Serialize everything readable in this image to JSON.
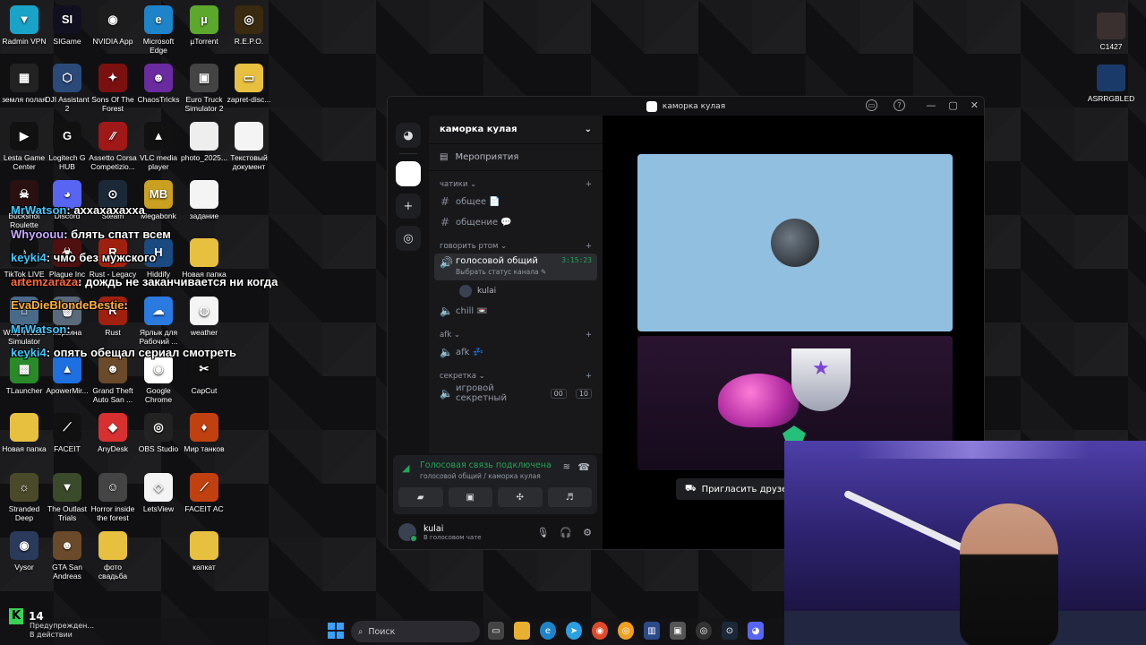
{
  "desktop": {
    "icons": [
      {
        "label": "Radmin VPN",
        "color": "#1aa3c9",
        "glyph": "▼"
      },
      {
        "label": "SIGame",
        "color": "#101020",
        "glyph": "SI"
      },
      {
        "label": "NVIDIA App",
        "color": "#1c1c1c",
        "glyph": "◉"
      },
      {
        "label": "Microsoft Edge",
        "color": "#1e84c9",
        "glyph": "e"
      },
      {
        "label": "µTorrent",
        "color": "#5ca82c",
        "glyph": "µ"
      },
      {
        "label": "R.E.P.O.",
        "color": "#3a2a10",
        "glyph": "◎"
      },
      {
        "label": "земля полая",
        "color": "#222",
        "glyph": "▦"
      },
      {
        "label": "DJI Assistant 2",
        "color": "#2b4a7a",
        "glyph": "⬡"
      },
      {
        "label": "Sons Of The Forest",
        "color": "#7a1010",
        "glyph": "✦"
      },
      {
        "label": "ChaosTricks",
        "color": "#6a2aa0",
        "glyph": "☻"
      },
      {
        "label": "Euro Truck Simulator 2",
        "color": "#444",
        "glyph": "▣"
      },
      {
        "label": "zapret-disc...",
        "color": "#e8c040",
        "glyph": "▭"
      },
      {
        "label": "Lesta Game Center",
        "color": "#111",
        "glyph": "▶"
      },
      {
        "label": "Logitech G HUB",
        "color": "#111",
        "glyph": "G"
      },
      {
        "label": "Assetto Corsa Competizio...",
        "color": "#a01818",
        "glyph": "⁄⁄"
      },
      {
        "label": "VLC media player",
        "color": "#111",
        "glyph": "▲"
      },
      {
        "label": "photo_2025...",
        "color": "#eee",
        "glyph": ""
      },
      {
        "label": "Текстовый документ",
        "color": "#f4f4f4",
        "glyph": ""
      },
      {
        "label": "Buckshot Roulette",
        "color": "#2a1010",
        "glyph": "☠"
      },
      {
        "label": "Discord",
        "color": "#5865f2",
        "glyph": "◕"
      },
      {
        "label": "Steam",
        "color": "#1b2838",
        "glyph": "⊙"
      },
      {
        "label": "Megabonk",
        "color": "#caa020",
        "glyph": "MB"
      },
      {
        "label": "задание",
        "color": "#f4f4f4",
        "glyph": ""
      },
      {
        "label": "TikTok LIVE Studio",
        "color": "#111",
        "glyph": "♪"
      },
      {
        "label": "Plague Inc Evolved",
        "color": "#501010",
        "glyph": "☣"
      },
      {
        "label": "Rust - Legacy",
        "color": "#a02010",
        "glyph": "R"
      },
      {
        "label": "Hiddify",
        "color": "#1a4a80",
        "glyph": "H"
      },
      {
        "label": "Новая папка",
        "color": "#e8c040",
        "glyph": ""
      },
      {
        "label": "Wrap House Simulator",
        "color": "#4a6a8a",
        "glyph": "⌂"
      },
      {
        "label": "Корзина",
        "color": "#5a6a7a",
        "glyph": "🗑"
      },
      {
        "label": "Rust",
        "color": "#a02010",
        "glyph": "R"
      },
      {
        "label": "Ярлык для Рабочий ...",
        "color": "#2a7ae0",
        "glyph": "☁"
      },
      {
        "label": "weather",
        "color": "#f4f4f4",
        "glyph": "◍"
      },
      {
        "label": "TLauncher",
        "color": "#2a8a2a",
        "glyph": "▩"
      },
      {
        "label": "ApowerMir...",
        "color": "#1e6fe0",
        "glyph": "▲"
      },
      {
        "label": "Grand Theft Auto San ...",
        "color": "#6a4a2a",
        "glyph": "☻"
      },
      {
        "label": "Google Chrome",
        "color": "#fff",
        "glyph": "◉"
      },
      {
        "label": "CapCut",
        "color": "#111",
        "glyph": "✂"
      },
      {
        "label": "Новая папка",
        "color": "#e8c040",
        "glyph": ""
      },
      {
        "label": "FACEIT",
        "color": "#111",
        "glyph": "⟋"
      },
      {
        "label": "AnyDesk",
        "color": "#d83030",
        "glyph": "◆"
      },
      {
        "label": "OBS Studio",
        "color": "#222",
        "glyph": "◎"
      },
      {
        "label": "Мир танков",
        "color": "#c04010",
        "glyph": "♦"
      },
      {
        "label": "Stranded Deep",
        "color": "#4a4a2a",
        "glyph": "☼"
      },
      {
        "label": "The Outlast Trials",
        "color": "#3a4a2a",
        "glyph": "▼"
      },
      {
        "label": "Horror inside the forest",
        "color": "#444",
        "glyph": "☺"
      },
      {
        "label": "LetsView",
        "color": "#f4f4f4",
        "glyph": "◇"
      },
      {
        "label": "FACEIT AC",
        "color": "#c04010",
        "glyph": "⟋"
      },
      {
        "label": "Vysor",
        "color": "#2a3a5a",
        "glyph": "◉"
      },
      {
        "label": "GTA San Andreas",
        "color": "#6a4a2a",
        "glyph": "☻"
      },
      {
        "label": "фото свадьба",
        "color": "#e8c040",
        "glyph": ""
      },
      {
        "label": "капкат",
        "color": "#e8c040",
        "glyph": ""
      }
    ],
    "right_icons": [
      {
        "label": "C1427"
      },
      {
        "label": "ASRRGBLED"
      }
    ]
  },
  "chat": [
    {
      "user": "MrWatson",
      "text": "аххахахахха",
      "color": "#3ec9ff"
    },
    {
      "user": "Whyoouu",
      "text": "блять спатт всем",
      "color": "#c9a8ff"
    },
    {
      "user": "keyki4",
      "text": "чмо без мужского",
      "color": "#3ec9ff"
    },
    {
      "user": "artemzaraza",
      "text": "дождь не заканчивается ни когда",
      "color": "#ff6a3e"
    },
    {
      "user": "EvaDieBlondeBestie",
      "text": "",
      "color": "#ffb23e"
    },
    {
      "user": "MrWatson",
      "text": "",
      "color": "#3ec9ff"
    },
    {
      "user": "keyki4",
      "text": "опять обещал сериал смотреть",
      "color": "#3ec9ff"
    }
  ],
  "discord": {
    "window_title": "каморка кулая",
    "guild_name": "каморка кулая",
    "events_label": "Мероприятия",
    "categories": [
      {
        "name": "чатики ⌄",
        "channels": [
          {
            "type": "text",
            "name": "общее 📄"
          },
          {
            "type": "text",
            "name": "общение 💬"
          }
        ]
      },
      {
        "name": "говорить ртом ⌄",
        "channels": [
          {
            "type": "voice",
            "name": "голосовой общий",
            "timer": "3:15:23",
            "status": "Выбрать статус канала ✎",
            "selected": true
          },
          {
            "type": "voice",
            "name": "chill 📼"
          }
        ]
      },
      {
        "name": "afk ⌄",
        "channels": [
          {
            "type": "voice",
            "name": "afk 💤"
          }
        ]
      },
      {
        "name": "секретка ⌄",
        "channels": [
          {
            "type": "voice",
            "name": "игровой секретный",
            "badge1": "00",
            "badge2": "10"
          }
        ]
      }
    ],
    "voice_user": "kulai",
    "voice_panel": {
      "status": "Голосовая связь подключена",
      "sub": "голосовой общий / каморка кулая"
    },
    "user": {
      "name": "kulai",
      "status": "В голосовом чате"
    },
    "invite_label": "Пригласить друзей"
  },
  "corner": {
    "count": "14",
    "notice_line1": "Предупрежден...",
    "notice_line2": "В действии"
  },
  "taskbar": {
    "search_placeholder": "Поиск"
  }
}
